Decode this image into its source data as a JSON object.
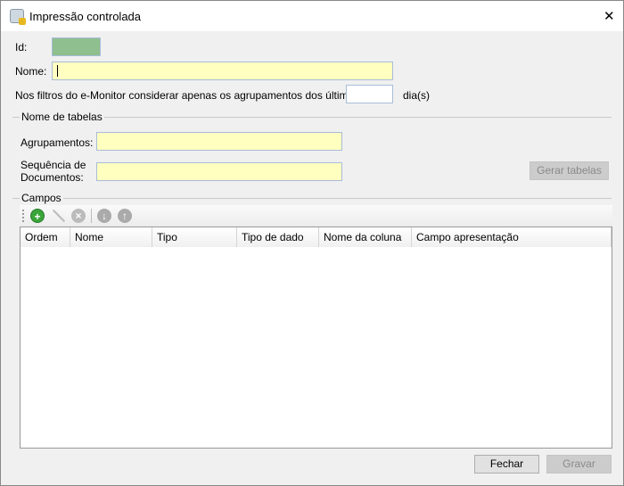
{
  "window": {
    "title": "Impressão controlada",
    "close": "✕"
  },
  "form": {
    "id_label": "Id:",
    "id_value": "",
    "nome_label": "Nome:",
    "nome_value": "",
    "filter_text": "Nos filtros do e-Monitor considerar apenas os agrupamentos dos últimos",
    "days_value": "",
    "days_unit": "dia(s)"
  },
  "tabelas": {
    "group_label": "Nome de tabelas",
    "agrupamentos_label": "Agrupamentos:",
    "agrupamentos_value": "",
    "sequencia_label_1": "Sequência de",
    "sequencia_label_2": "Documentos:",
    "sequencia_value": "",
    "gerar_button": "Gerar tabelas"
  },
  "campos": {
    "group_label": "Campos",
    "columns": [
      "Ordem",
      "Nome",
      "Tipo",
      "Tipo de dado",
      "Nome da coluna",
      "Campo apresentação"
    ]
  },
  "footer": {
    "fechar": "Fechar",
    "gravar": "Gravar"
  },
  "colors": {
    "id_field": "#8fbf8f",
    "input_yellow": "#ffffc0",
    "add_green": "#3aa53a"
  }
}
